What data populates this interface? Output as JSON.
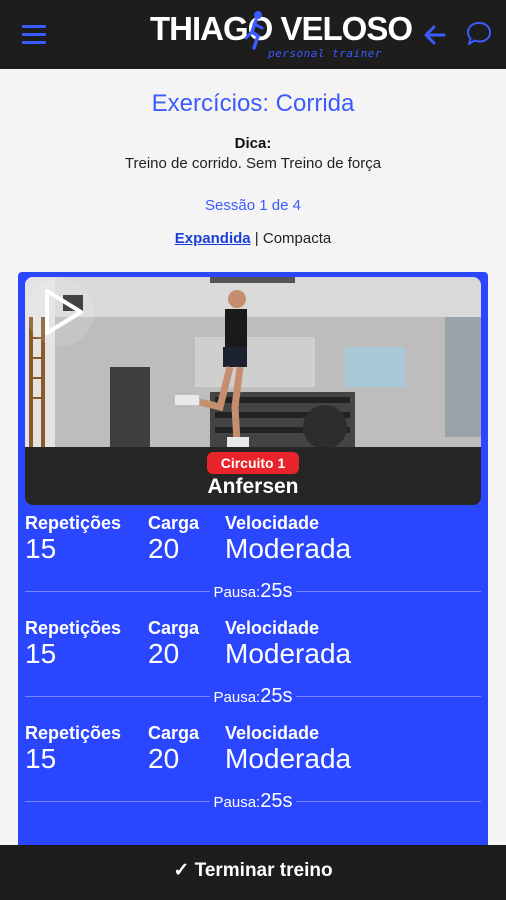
{
  "header": {
    "logo_text": "THIAGO VELOSO",
    "logo_subtitle": "personal trainer",
    "icons": {
      "menu": "hamburger-menu-icon",
      "back": "arrow-left-icon",
      "chat": "chat-bubble-icon"
    },
    "accent_color": "#3d5afe"
  },
  "page": {
    "title": "Exercícios: Corrida",
    "tip_label": "Dica:",
    "tip_text": "Treino de corrido. Sem Treino de força",
    "session": "Sessão 1 de 4",
    "view_expanded": "Expandida",
    "view_separator": " | ",
    "view_compact": "Compacta"
  },
  "exercise": {
    "circuit_badge": "Circuito 1",
    "name": "Anfersen",
    "card_color": "#2b46ff",
    "badge_color": "#e8232a",
    "sets": [
      {
        "reps_label": "Repetições",
        "reps": "15",
        "load_label": "Carga",
        "load": "20",
        "speed_label": "Velocidade",
        "speed": "Moderada",
        "pause_label": "Pausa:",
        "pause": "25s"
      },
      {
        "reps_label": "Repetições",
        "reps": "15",
        "load_label": "Carga",
        "load": "20",
        "speed_label": "Velocidade",
        "speed": "Moderada",
        "pause_label": "Pausa:",
        "pause": "25s"
      },
      {
        "reps_label": "Repetições",
        "reps": "15",
        "load_label": "Carga",
        "load": "20",
        "speed_label": "Velocidade",
        "speed": "Moderada",
        "pause_label": "Pausa:",
        "pause": "25s"
      }
    ]
  },
  "footer": {
    "finish_label": "✓ Terminar treino"
  }
}
